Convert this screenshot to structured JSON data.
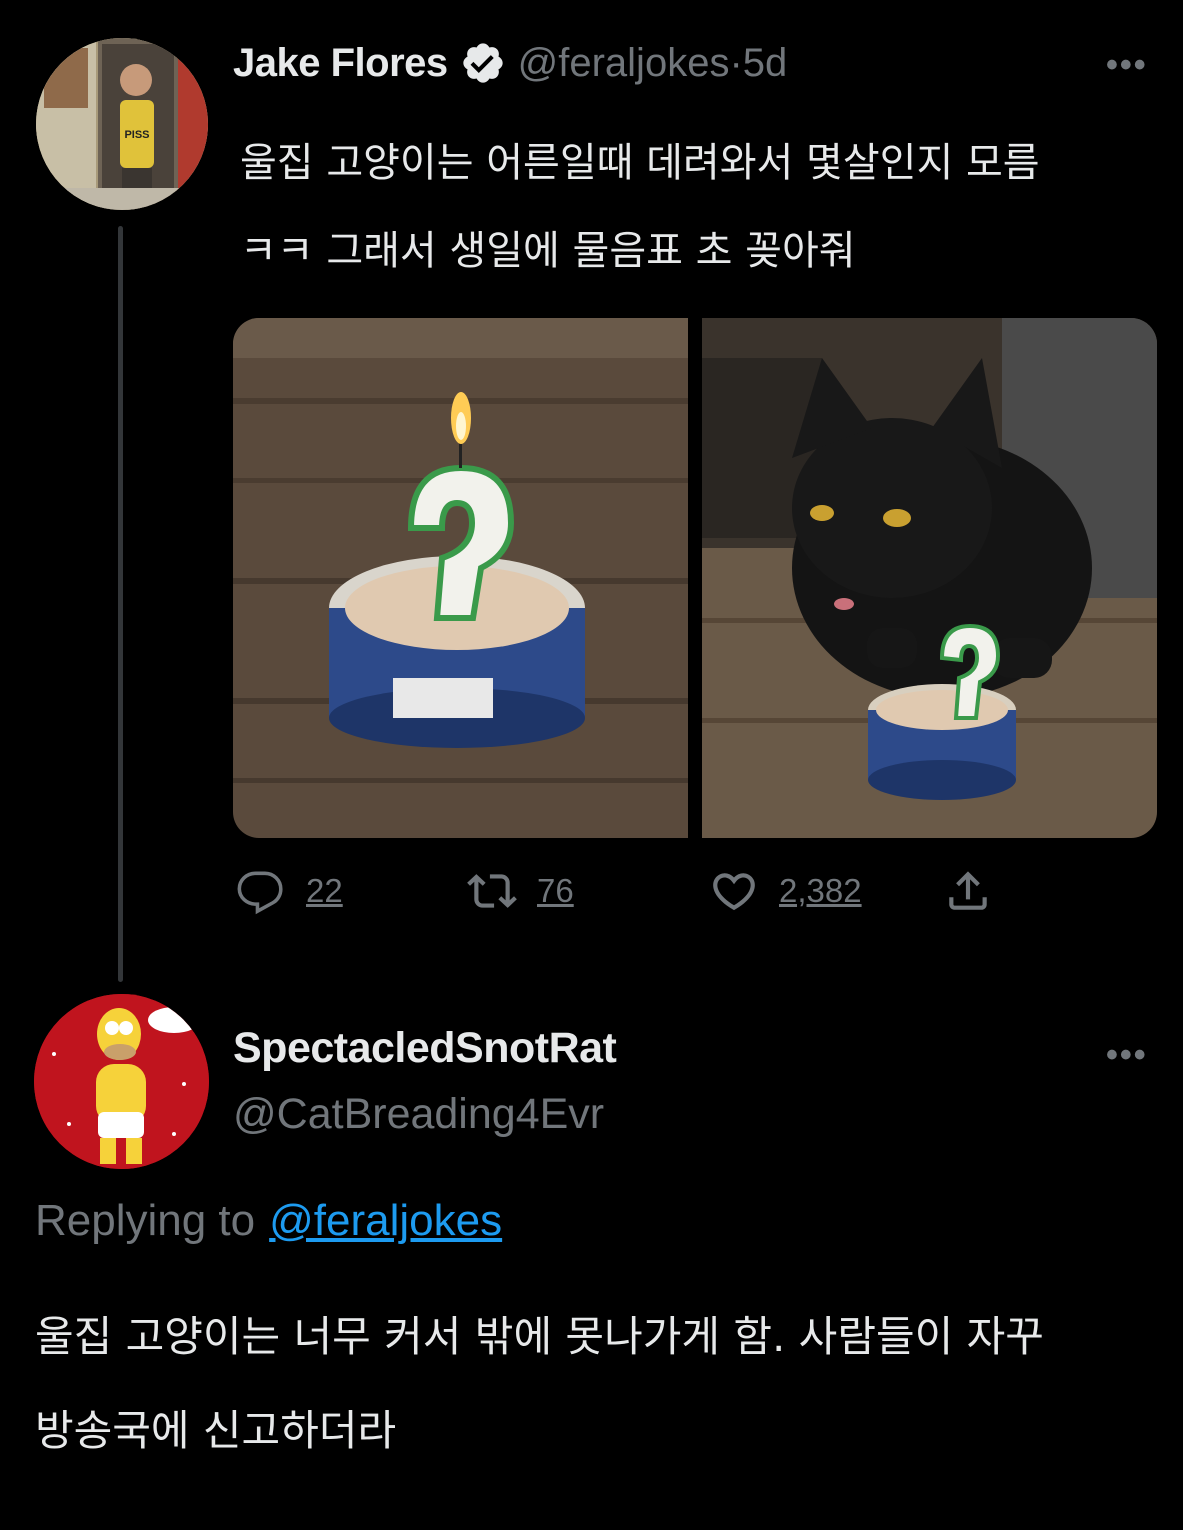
{
  "tweet": {
    "author_name": "Jake Flores",
    "author_handle": "@feraljokes",
    "separator": " · ",
    "time_ago": "5d",
    "more_label": "•••",
    "text_line1": "울집 고양이는 어른일때 데려와서 몇살인지 모름",
    "text_line2": "ㅋㅋ 그래서 생일에 물음표 초 꽂아줘",
    "avatar_shirt_text": "PISS",
    "media": [
      {
        "description": "question-mark-candle-on-cat-food-can"
      },
      {
        "description": "black-cat-with-candle-cat-food-can"
      }
    ],
    "stats": {
      "replies": "22",
      "retweets": "76",
      "likes": "2,382"
    }
  },
  "reply": {
    "author_name": "SpectacledSnotRat",
    "author_handle": "@CatBreading4Evr",
    "more_label": "•••",
    "replying_prefix": "Replying to",
    "replying_mention": "@feraljokes",
    "text_line1": "울집 고양이는 너무 커서 밖에 못나가게 함. 사람들이 자꾸",
    "text_line2": "방송국에 신고하더라"
  },
  "colors": {
    "background": "#000000",
    "text_primary": "#e7e9ea",
    "text_secondary": "#71767b",
    "accent": "#1d9bf0",
    "thread_line": "#333639"
  }
}
